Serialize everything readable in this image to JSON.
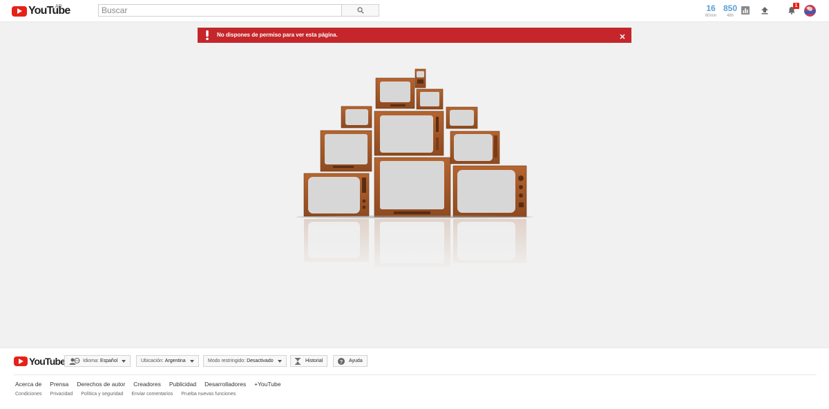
{
  "header": {
    "logo_text": "YouTube",
    "country": "AR",
    "search_placeholder": "Buscar",
    "stats": [
      {
        "value": "16",
        "label": "60min"
      },
      {
        "value": "850",
        "label": "48h"
      }
    ],
    "notification_count": "1",
    "icons": [
      "search-icon",
      "analytics-icon",
      "upload-icon",
      "bell-icon"
    ]
  },
  "alert": {
    "message": "No dispones de permiso para ver esta página.",
    "color": "#c4262b"
  },
  "footer": {
    "logo_text": "YouTube",
    "buttons": [
      {
        "label": "Idioma:",
        "value": "Español"
      },
      {
        "label": "Ubicación:",
        "value": "Argentina"
      },
      {
        "label": "Modo restringido:",
        "value": "Desactivado"
      },
      {
        "label": "Historial"
      },
      {
        "label": "Ayuda"
      }
    ],
    "links": [
      "Acerca de",
      "Prensa",
      "Derechos de autor",
      "Creadores",
      "Publicidad",
      "Desarrolladores",
      "+YouTube"
    ],
    "sublinks": [
      "Condiciones",
      "Privacidad",
      "Política y seguridad",
      "Enviar comentarios",
      "Prueba nuevas funciones"
    ]
  },
  "colors": {
    "brand_red": "#e62117",
    "stat_blue": "#5a9fd6",
    "tv_wood": "#a0582a",
    "screen": "#d7d7d7"
  }
}
